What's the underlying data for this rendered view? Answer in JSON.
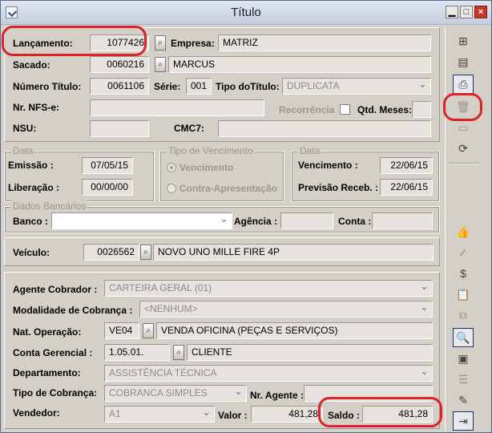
{
  "window": {
    "title": "Título"
  },
  "header": {
    "lancamento_label": "Lançamento:",
    "lancamento_value": "1077426",
    "empresa_label": "Empresa:",
    "empresa_value": "MATRIZ",
    "sacado_label": "Sacado:",
    "sacado_code": "0060216",
    "sacado_name": "MARCUS",
    "numero_label": "Número Título:",
    "numero_value": "0061106",
    "serie_label": "Série:",
    "serie_value": "001",
    "tipo_titulo_label": "Tipo doTítulo:",
    "tipo_titulo_value": "DUPLICATA",
    "nfse_label": "Nr. NFS-e:",
    "nfse_value": "",
    "recorrencia_label": "Recorrência",
    "qtd_meses_label": "Qtd. Meses:",
    "qtd_meses_value": "",
    "nsu_label": "NSU:",
    "nsu_value": "",
    "cmc7_label": "CMC7:",
    "cmc7_value": ""
  },
  "data_group": {
    "legend": "Data",
    "emissao_label": "Emissão :",
    "emissao_value": "07/05/15",
    "liberacao_label": "Liberação :",
    "liberacao_value": "00/00/00"
  },
  "tipo_venc_group": {
    "legend": "Tipo de Vencimento",
    "opt1": "Vencimento",
    "opt2": "Contra-Apresentação"
  },
  "data_venc_group": {
    "legend": "Data",
    "vencimento_label": "Vencimento :",
    "vencimento_value": "22/06/15",
    "previsao_label": "Previsão Receb. :",
    "previsao_value": "22/06/15"
  },
  "bancarios": {
    "legend": "Dados Bancários",
    "banco_label": "Banco :",
    "banco_value": "",
    "agencia_label": "Agência :",
    "agencia_value": "",
    "conta_label": "Conta :",
    "conta_value": ""
  },
  "veiculo": {
    "label": "Veículo:",
    "code": "0026562",
    "name": "NOVO UNO MILLE FIRE 4P"
  },
  "details": {
    "agente_label": "Agente Cobrador :",
    "agente_value": "CARTEIRA GERAL (01)",
    "modalidade_label": "Modalidade de Cobrança :",
    "modalidade_value": "<NENHUM>",
    "natop_label": "Nat. Operação:",
    "natop_code": "VE04",
    "natop_name": "VENDA OFICINA (PEÇAS E SERVIÇOS)",
    "conta_ger_label": "Conta Gerencial :",
    "conta_ger_code": "1.05.01.",
    "conta_ger_name": "CLIENTE",
    "depto_label": "Departamento:",
    "depto_value": "ASSISTÊNCIA TÉCNICA",
    "tipo_cob_label": "Tipo de Cobrança:",
    "tipo_cob_value": "COBRANCA SIMPLES",
    "nr_agente_label": "Nr. Agente :",
    "nr_agente_value": "",
    "vendedor_label": "Vendedor:",
    "vendedor_value": "A1",
    "valor_label": "Valor :",
    "valor_value": "481,28",
    "saldo_label": "Saldo :",
    "saldo_value": "481,28"
  },
  "toolbar_icons": [
    "add-rows-icon",
    "table-edit-icon",
    "print-preview-icon",
    "delete-icon",
    "open-folder-icon",
    "refresh-icon",
    "thumbs-up-icon",
    "checkmark-icon",
    "money-bag-icon",
    "clipboard-icon",
    "copy-icon",
    "search-doc-icon",
    "document-icon",
    "zoom-list-icon",
    "edit-icon",
    "exit-icon"
  ],
  "highlight_color": "#e0202a"
}
